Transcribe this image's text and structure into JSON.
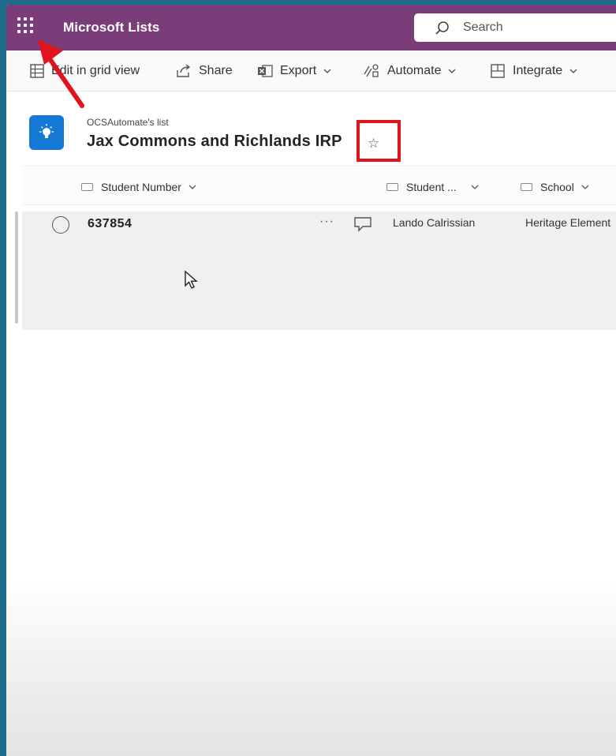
{
  "suite": {
    "app_title": "Microsoft Lists",
    "search_placeholder": "Search"
  },
  "command_bar": {
    "items": [
      {
        "label": "Edit in grid view",
        "icon": "grid-icon"
      },
      {
        "label": "Share",
        "icon": "share-icon"
      },
      {
        "label": "Export",
        "icon": "excel-icon"
      },
      {
        "label": "Automate",
        "icon": "automate-icon"
      },
      {
        "label": "Integrate",
        "icon": "integrate-icon"
      }
    ]
  },
  "list": {
    "owner": "OCSAutomate's list",
    "title": "Jax Commons and Richlands IRP",
    "favorite_glyph": "☆"
  },
  "columns": [
    {
      "label": "Student Number"
    },
    {
      "label": "Student ..."
    },
    {
      "label": "School"
    }
  ],
  "rows": [
    {
      "student_number": "637854",
      "student_name": "Lando Calrissian",
      "school": "Heritage Element",
      "more": "···"
    }
  ],
  "colors": {
    "suite_bar": "#7b3d79",
    "accent_blue": "#1578d4",
    "annotation_red": "#e0141c"
  }
}
